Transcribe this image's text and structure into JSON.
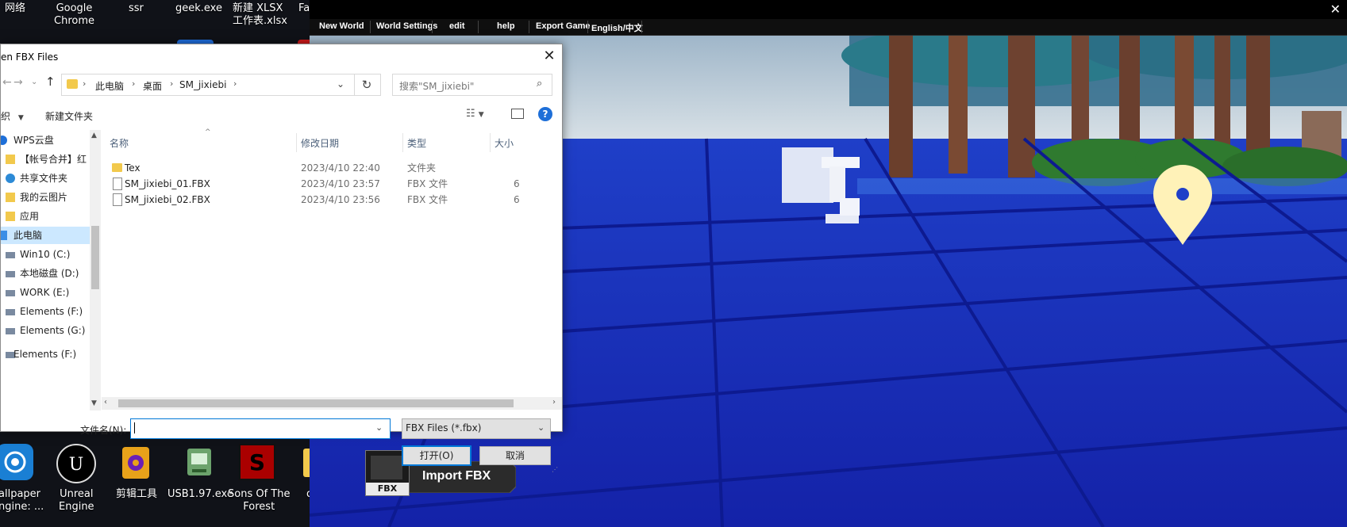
{
  "desktop": {
    "top_icons": [
      {
        "label": "网络"
      },
      {
        "label": "Google Chrome",
        "line1": "Google",
        "line2": "Chrome"
      },
      {
        "label": "ssr"
      },
      {
        "label": "geek.exe"
      },
      {
        "label": "新建 XLSX 工作表.xlsx",
        "line1": "新建 XLSX",
        "line2": "工作表.xlsx"
      },
      {
        "label": "FaceRig"
      }
    ],
    "bottom_icons": [
      {
        "line1": "allpaper",
        "line2": "ngine: ..."
      },
      {
        "line1": "Unreal",
        "line2": "Engine"
      },
      {
        "line1": "剪辑工具",
        "line2": ""
      },
      {
        "line1": "USB1.97.exe",
        "line2": ""
      },
      {
        "line1": "Sons Of The",
        "line2": "Forest"
      },
      {
        "line1": "obj",
        "line2": ""
      }
    ]
  },
  "game": {
    "menu": [
      "New World",
      "World Settings",
      "edit",
      "help",
      "Export Game",
      "English/中文"
    ],
    "close_glyph": "✕",
    "import_button": {
      "label": "Import FBX",
      "icon_text": "FBX"
    }
  },
  "dialog": {
    "title": "en FBX Files",
    "close_glyph": "✕",
    "breadcrumb": [
      "此电脑",
      "桌面",
      "SM_jixiebi"
    ],
    "search_placeholder": "搜索\"SM_jixiebi\"",
    "cmdbar": {
      "organize": "织",
      "new_folder": "新建文件夹"
    },
    "nav_items": [
      {
        "label": "WPS云盘",
        "icon": "cloud-icon",
        "selected": false
      },
      {
        "label": "【帐号合并】红",
        "icon": "folder-icon",
        "selected": false
      },
      {
        "label": "共享文件夹",
        "icon": "share-icon",
        "selected": false
      },
      {
        "label": "我的云图片",
        "icon": "folder-icon",
        "selected": false
      },
      {
        "label": "应用",
        "icon": "folder-icon",
        "selected": false
      },
      {
        "label": "此电脑",
        "icon": "computer-icon",
        "selected": true
      },
      {
        "label": "Win10 (C:)",
        "icon": "drive-icon",
        "selected": false
      },
      {
        "label": "本地磁盘 (D:)",
        "icon": "drive-icon",
        "selected": false
      },
      {
        "label": "WORK (E:)",
        "icon": "drive-icon",
        "selected": false
      },
      {
        "label": "Elements (F:)",
        "icon": "drive-icon",
        "selected": false
      },
      {
        "label": "Elements (G:)",
        "icon": "drive-icon",
        "selected": false
      },
      {
        "label": "Elements (F:)",
        "icon": "drive-icon",
        "selected": false
      }
    ],
    "columns": [
      "名称",
      "修改日期",
      "类型",
      "大小"
    ],
    "files": [
      {
        "name": "Tex",
        "date": "2023/4/10 22:40",
        "type": "文件夹",
        "size": "",
        "icon": "folder-icon"
      },
      {
        "name": "SM_jixiebi_01.FBX",
        "date": "2023/4/10 23:57",
        "type": "FBX 文件",
        "size": "6",
        "icon": "file-icon"
      },
      {
        "name": "SM_jixiebi_02.FBX",
        "date": "2023/4/10 23:56",
        "type": "FBX 文件",
        "size": "6",
        "icon": "file-icon"
      }
    ],
    "filename_label": "文件名(N):",
    "filename_value": "",
    "filetype": "FBX Files (*.fbx)",
    "open_label": "打开(O)",
    "cancel_label": "取消"
  }
}
